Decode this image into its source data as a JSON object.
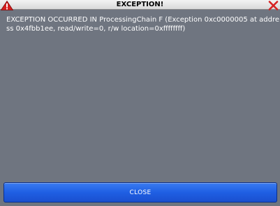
{
  "dialog": {
    "title": "EXCEPTION!",
    "message": "EXCEPTION OCCURRED IN ProcessingChain F (Exception 0xc0000005 at address 0x4fbb1ee, read/write=0, r/w location=0xffffffff)",
    "close_label": "CLOSE"
  },
  "icons": {
    "title_left": "warning-triangle-icon",
    "title_right": "close-x-icon"
  },
  "colors": {
    "dialog_background": "#6f7580",
    "button_blue": "#1f5fe3",
    "warning_red": "#d61f1f",
    "close_x_red": "#d62222"
  }
}
